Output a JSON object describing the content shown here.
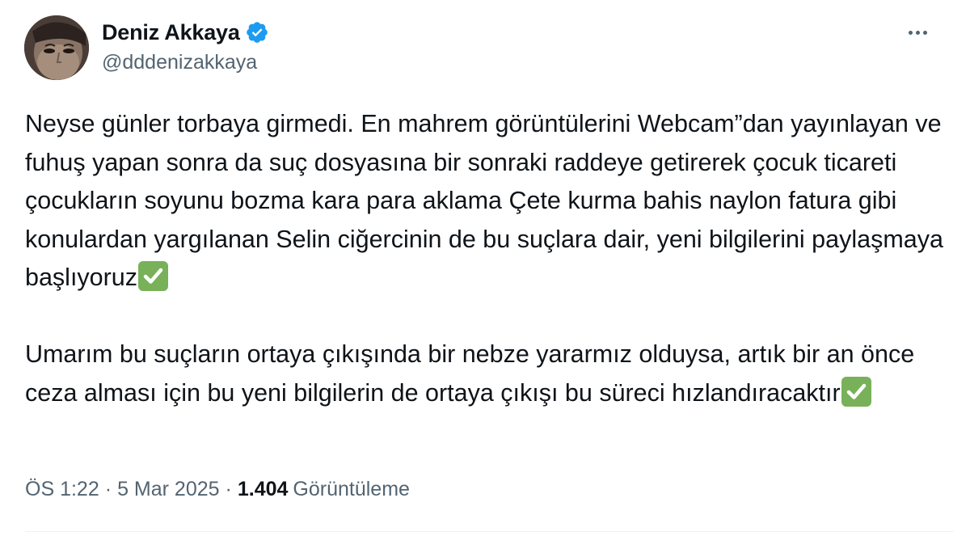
{
  "author": {
    "display_name": "Deniz Akkaya",
    "handle": "@dddenizakkaya",
    "verified": true
  },
  "tweet": {
    "paragraphs": [
      "Neyse günler torbaya girmedi. En mahrem görüntülerini Webcam”dan yayınlayan ve fuhuş yapan sonra da suç dosyasına bir sonraki raddeye getirerek çocuk ticareti çocukların soyunu bozma kara para aklama Çete kurma bahis naylon fatura gibi konulardan yargılanan Selin ciğercinin de bu suçlara dair, yeni bilgilerini paylaşmaya başlıyoruz",
      "Umarım bu suçların ortaya çıkışında bir nebze yararmız olduysa, artık bir an önce ceza alması için bu yeni bilgilerin de ortaya çıkışı bu süreci hızlandıracaktır"
    ],
    "trailing_emoji": "check-mark-button-icon"
  },
  "meta": {
    "time": "ÖS 1:22",
    "separator": "·",
    "date": "5 Mar 2025",
    "views_count": "1.404",
    "views_label": "Görüntüleme"
  },
  "colors": {
    "text_primary": "#0f1419",
    "text_secondary": "#536471",
    "verified_blue": "#1d9bf0",
    "check_green": "#78b159",
    "divider": "#eff3f4"
  }
}
